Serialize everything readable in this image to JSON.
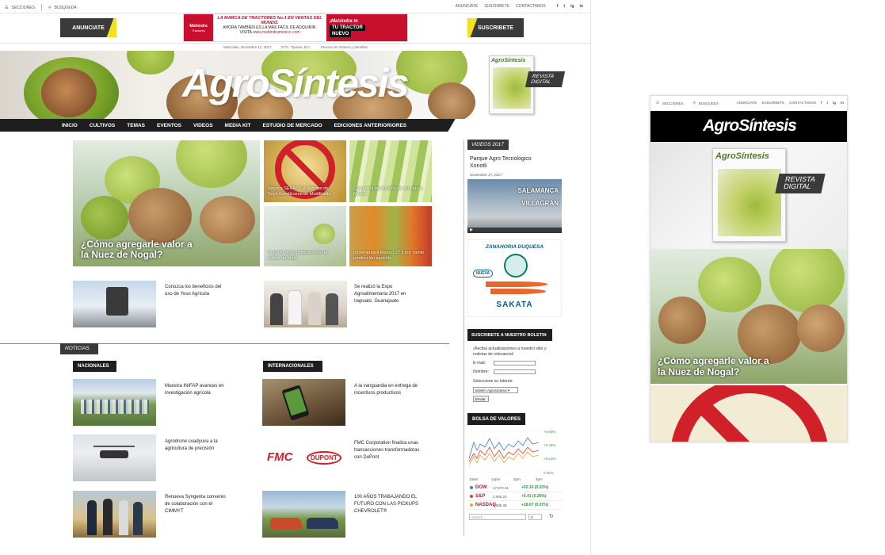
{
  "desktop": {
    "topbar": {
      "sections": "SECCIONES",
      "search": "BUSQUEDA",
      "links": [
        "ANUNCIATE",
        "SUSCRIBETE",
        "CONTACTANOS"
      ],
      "social": [
        "f",
        "t",
        "ig",
        "in"
      ]
    },
    "header": {
      "advertise": "ANUNCIATE",
      "subscribe": "SUSCRIBETE",
      "ad": {
        "brand": "Mahindra",
        "brand_sub": "Tractores",
        "line1": "LA MARCA DE TRACTORES No.1 EN VENTAS DEL MUNDO.",
        "line2": "AHORA TAMBIEN ES LA MAS FACIL DE ADQUIRIR.",
        "line3": "VISITA",
        "url": "www.mahindramexico.com",
        "cta1": "¡Mahindra te",
        "cta2": "TU TRACTOR",
        "cta3": "NUEVO"
      }
    },
    "dateline": {
      "date": "Miercoles, Diciembre 11, 2017",
      "weather": "27ºC, Tijuana, B.C.",
      "prices": "Precios de Granos y Semillas"
    },
    "logo": "AgroSíntesis",
    "magazine": {
      "title": "AgroSíntesis",
      "badge_line1": "REVISTA",
      "badge_line2": "DIGITAL"
    },
    "nav": [
      "INICIO",
      "CULTIVOS",
      "TEMAS",
      "EVENTOS",
      "VIDEOS",
      "MEDIA KIT",
      "ESTUDIO DE MERCADO",
      "EDICIONES ANTERIORIORES"
    ],
    "featured": {
      "main_caption": "¿Cómo agregarle valor a la Nuez de Nogal?",
      "tiles": [
        "Revoca SENASICA permiso de Soya Genéticamente Modificada",
        "Crecerá la producción de azúcar en México",
        "Cuidado de Lepidópteros en el cultivo de Maíz",
        "Incrementará México 27.8 por ciento producción agrícola"
      ]
    },
    "stories_top": [
      "Conozca los beneficios del uso de Yeso Agrícola",
      "Se realizó la Expo Agroalimentaria 2017 en Irapuato, Guanajuato"
    ],
    "noticias": {
      "tag": "NOTICIAS",
      "nacionales": {
        "label": "NACIONALES",
        "items": [
          "Muestra INIFAP avances en investigación agrícola",
          "Agrodrone coadyuva a la agricultura de precisión",
          "Renueva Syngenta convenio de colaboración con el CIMMYT"
        ]
      },
      "internacionales": {
        "label": "INTERNACIONALES",
        "items": [
          "A la vanguardia en entrega de incentivos productivos",
          "FMC Corporation finaliza unas transacciones transformadoras con DuPont",
          "100 AÑOS TRABAJANDO EL FUTURO CON LAS PICKUPS CHEVROLET®"
        ]
      },
      "logos": {
        "fmc": "FMC",
        "dupont": "DUPONT"
      }
    },
    "sidebar": {
      "videos_tag": "VIDEOS 2017",
      "video_title": "Parque Agro Tecnológico Xonotli",
      "video_date": "Noviembre 17, 2017",
      "video_overlay1": "SALAMANCA",
      "video_overlay2": "VILLAGRÁN",
      "ad": {
        "title": "ZANAHORIA DUQUESA",
        "badge": "NUEVA",
        "brand": "SAKATA"
      },
      "newsletter": {
        "tag": "SUSCRIBETE A NUESTRO BOLETIN",
        "text": "¡Reciba actualizaciones a nuestro sitio y noticias de relevancia!",
        "email_label": "E-mail:",
        "name_label": "Nombre:",
        "interest_label": "Seleccione su interés:",
        "select_value": "Boletín Agrosíntesis",
        "send": "Enviar"
      },
      "bolsa": {
        "tag": "BOLSA DE VALORES",
        "y_labels": [
          "+0.63%",
          "+0.42%",
          "+0.21%",
          "0.00%"
        ],
        "x_labels": [
          "10am",
          "12pm",
          "2pm",
          "4pm"
        ],
        "stocks": [
          {
            "name": "DOW",
            "value": "17,972.01",
            "change": "+92.16 (0.52%)",
            "color": "#3b7dd8"
          },
          {
            "name": "S&P",
            "value": "2,086.23",
            "change": "+5.41 (0.26%)",
            "color": "#d8423b"
          },
          {
            "name": "NASDAQ",
            "value": "4,935.38",
            "change": "+18.07 (0.37%)",
            "color": "#e8a23a"
          }
        ],
        "search_placeholder": "Search...",
        "search_sel": "4"
      }
    }
  },
  "mobile": {
    "sections": "SECCIONES",
    "search": "BUSQUEDA",
    "links": [
      "ANUNCIATE",
      "SUSCRIBETE",
      "CONTACTANOS"
    ],
    "logo": "AgroSíntesis",
    "magazine_title": "AgroSíntesis",
    "badge_line1": "REVISTA",
    "badge_line2": "DIGITAL",
    "caption": "¿Cómo agregarle valor a la Nuez de Nogal?"
  }
}
